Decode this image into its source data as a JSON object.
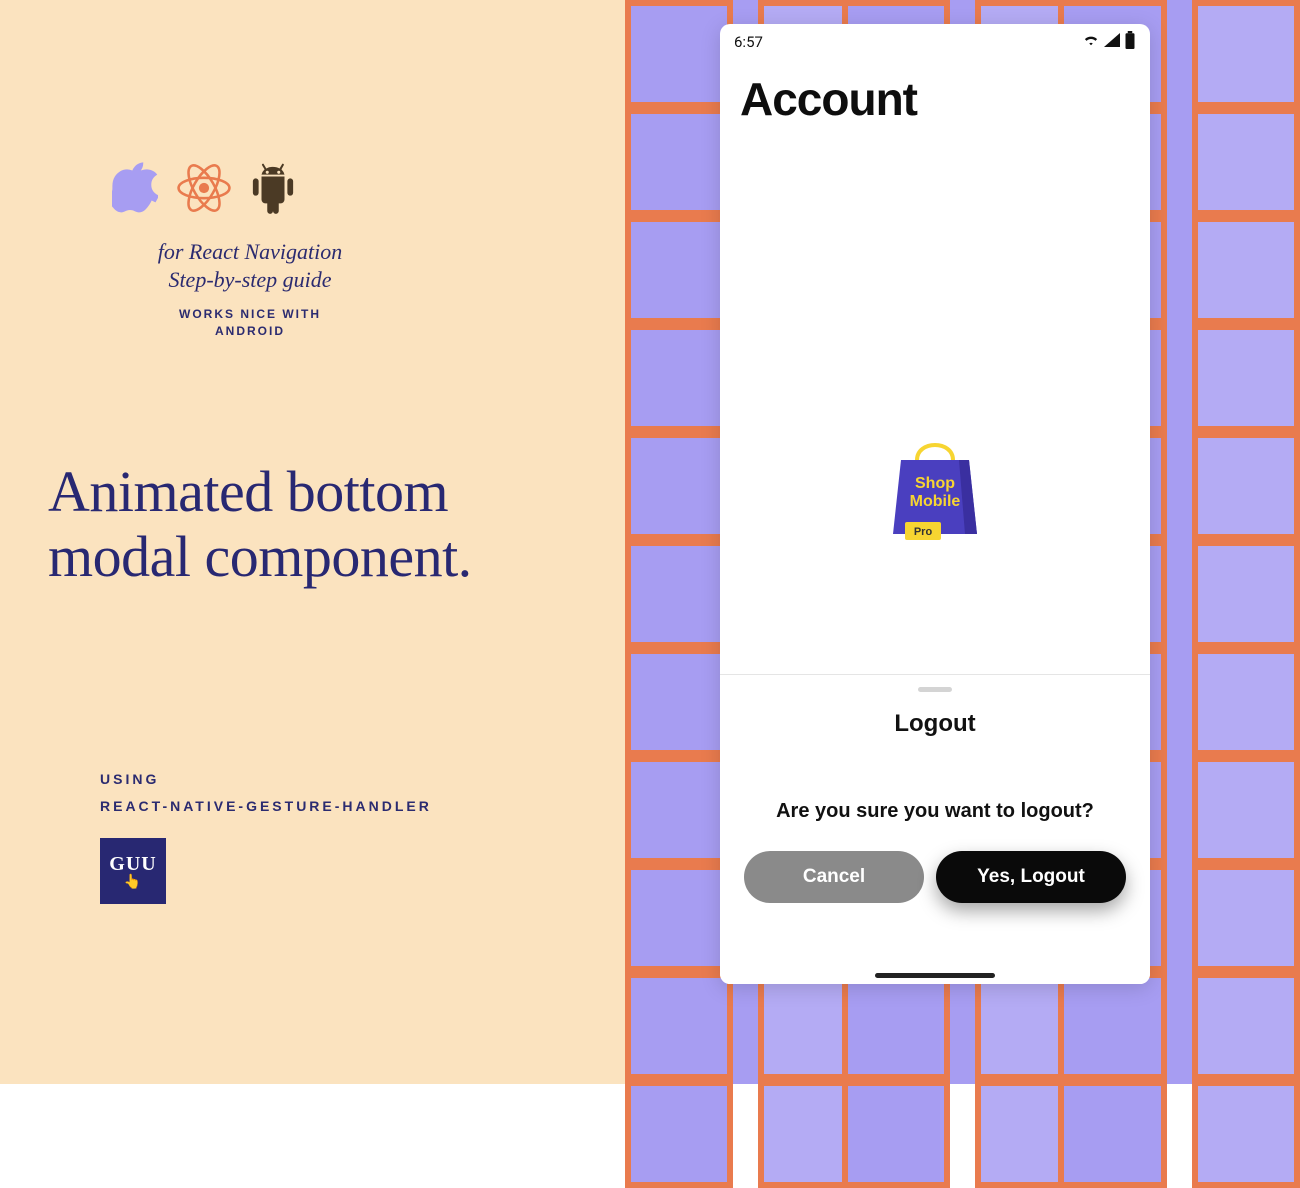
{
  "left": {
    "icons": {
      "apple": "apple-icon",
      "react": "react-icon",
      "android": "android-icon"
    },
    "tagline_line1": "for React Navigation",
    "tagline_line2": "Step-by-step guide",
    "works_nice_line1": "WORKS NICE WITH",
    "works_nice_line2": "ANDROID",
    "headline_line1": "Animated bottom",
    "headline_line2": "modal component.",
    "using_line1": "USING",
    "using_line2": "REACT-NATIVE-GESTURE-HANDLER",
    "brand_label": "GUU",
    "brand_emoji": "👆"
  },
  "phone": {
    "status_time": "6:57",
    "title": "Account",
    "bag": {
      "line1": "Shop",
      "line2": "Mobile",
      "badge": "Pro"
    },
    "sheet": {
      "title": "Logout",
      "message": "Are you sure you want to logout?",
      "cancel": "Cancel",
      "confirm": "Yes, Logout"
    }
  },
  "colors": {
    "bg_left": "#fbe3bf",
    "navy": "#282872",
    "lilac": "#a79df2",
    "mortar": "#e97b4e",
    "bag_purple": "#4a3fbf",
    "bag_yellow": "#f7d531"
  }
}
